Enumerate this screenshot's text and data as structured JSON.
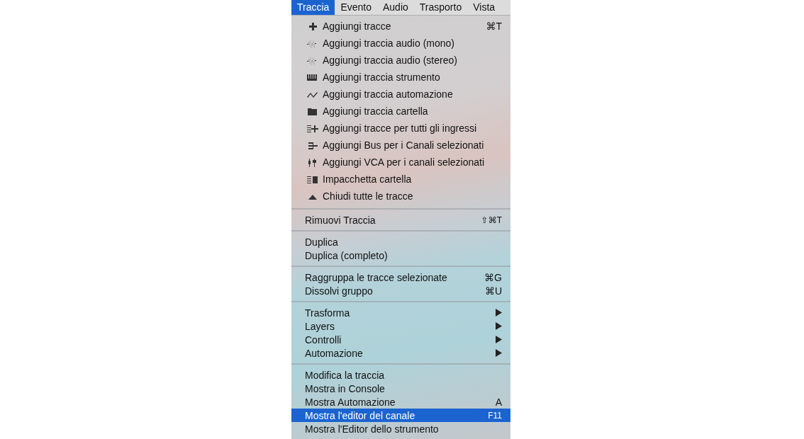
{
  "menu_bar": [
    {
      "label": "Traccia",
      "selected": true
    },
    {
      "label": "Evento",
      "selected": false
    },
    {
      "label": "Audio",
      "selected": false
    },
    {
      "label": "Trasporto",
      "selected": false
    },
    {
      "label": "Vista",
      "selected": false
    }
  ],
  "menu": {
    "groups": [
      {
        "kind": "icon",
        "items": [
          {
            "label": "Aggiungi tracce",
            "shortcut": "⌘T",
            "selected": false
          },
          {
            "label": "Aggiungi traccia audio (mono)",
            "selected": false
          },
          {
            "label": "Aggiungi traccia audio (stereo)",
            "selected": false
          },
          {
            "label": "Aggiungi traccia strumento",
            "selected": false
          },
          {
            "label": "Aggiungi traccia automazione",
            "selected": false
          },
          {
            "label": "Aggiungi traccia cartella",
            "selected": false
          },
          {
            "label": "Aggiungi tracce per tutti gli ingressi",
            "selected": false
          },
          {
            "label": "Aggiungi Bus per i Canali selezionati",
            "selected": false
          },
          {
            "label": "Aggiungi VCA per i canali selezionati",
            "selected": false
          },
          {
            "label": "Impacchetta cartella",
            "selected": false
          },
          {
            "label": "Chiudi tutte le tracce",
            "selected": false
          }
        ]
      },
      {
        "kind": "plain",
        "items": [
          {
            "label": "Rimuovi Traccia",
            "shortcut": "⇧⌘T",
            "selected": false
          }
        ]
      },
      {
        "kind": "plain",
        "items": [
          {
            "label": "Duplica",
            "selected": false
          },
          {
            "label": "Duplica (completo)",
            "selected": false
          }
        ]
      },
      {
        "kind": "plain",
        "items": [
          {
            "label": "Raggruppa le tracce selezionate",
            "shortcut": "⌘G",
            "selected": false
          },
          {
            "label": "Dissolvi gruppo",
            "shortcut": "⌘U",
            "selected": false
          }
        ]
      },
      {
        "kind": "plain",
        "items": [
          {
            "label": "Trasforma",
            "submenu": true,
            "selected": false
          },
          {
            "label": "Layers",
            "submenu": true,
            "selected": false
          },
          {
            "label": "Controlli",
            "submenu": true,
            "selected": false
          },
          {
            "label": "Automazione",
            "submenu": true,
            "selected": false
          }
        ]
      },
      {
        "kind": "plain",
        "items": [
          {
            "label": "Modifica la traccia",
            "selected": false
          },
          {
            "label": "Mostra in Console",
            "selected": false
          },
          {
            "label": "Mostra Automazione",
            "shortcut": "A",
            "selected": false
          },
          {
            "label": "Mostra l'editor del canale",
            "shortcut": "F11",
            "selected": true
          },
          {
            "label": "Mostra l'Editor dello strumento",
            "selected": false
          }
        ]
      }
    ]
  }
}
